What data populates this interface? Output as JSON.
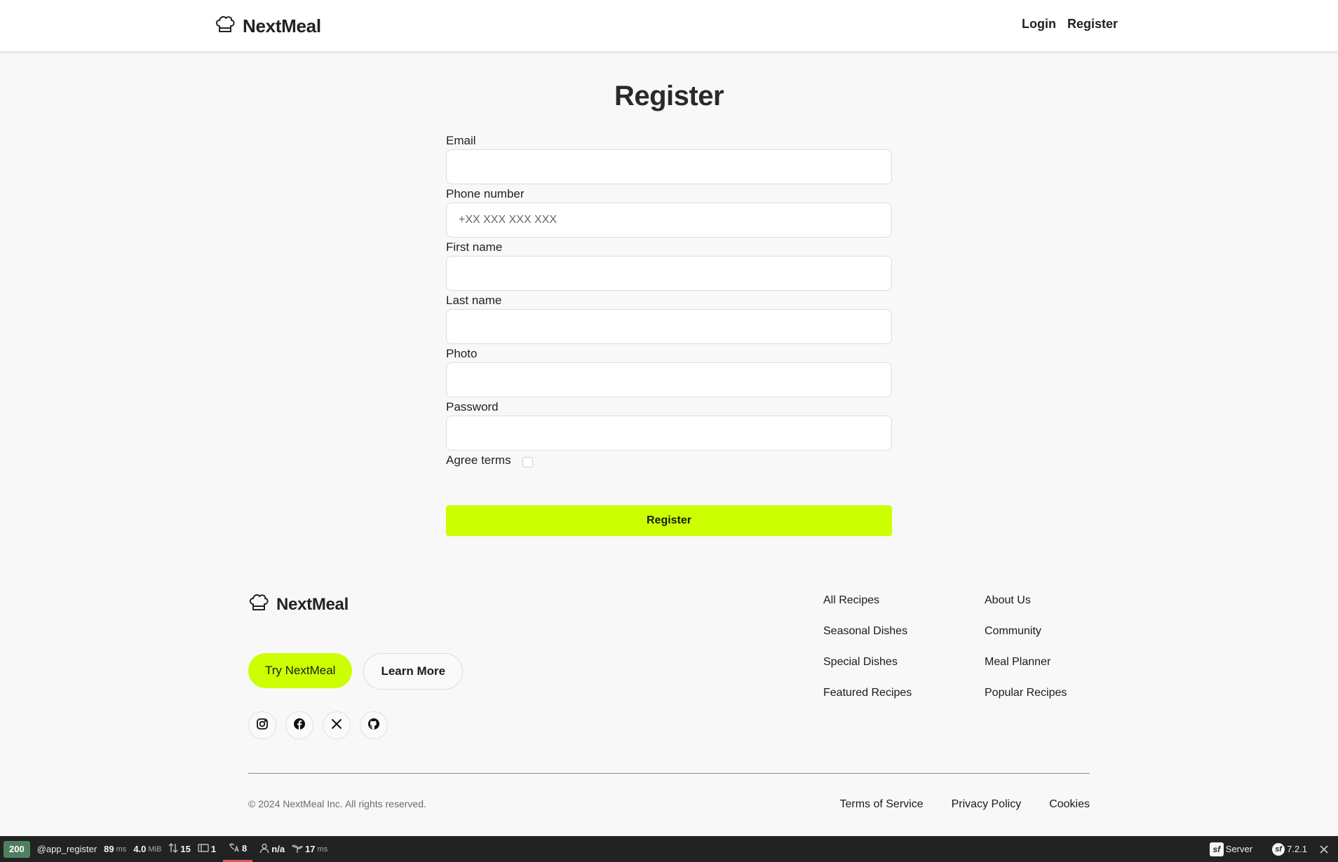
{
  "header": {
    "brand": "NextMeal",
    "nav": [
      "Login",
      "Register"
    ]
  },
  "page": {
    "title": "Register"
  },
  "form": {
    "fields": [
      {
        "label": "Email",
        "value": "",
        "placeholder": ""
      },
      {
        "label": "Phone number",
        "value": "",
        "placeholder": "+XX XXX XXX XXX"
      },
      {
        "label": "First name",
        "value": "",
        "placeholder": ""
      },
      {
        "label": "Last name",
        "value": "",
        "placeholder": ""
      },
      {
        "label": "Photo",
        "value": "",
        "placeholder": ""
      },
      {
        "label": "Password",
        "value": "",
        "placeholder": ""
      }
    ],
    "agree_label": "Agree terms",
    "agree_checked": false,
    "submit_label": "Register"
  },
  "footer": {
    "brand": "NextMeal",
    "cta_primary": "Try NextMeal",
    "cta_secondary": "Learn More",
    "socials": [
      "instagram-icon",
      "facebook-icon",
      "x-icon",
      "github-icon"
    ],
    "links_col1": [
      "All Recipes",
      "Seasonal Dishes",
      "Special Dishes",
      "Featured Recipes"
    ],
    "links_col2": [
      "About Us",
      "Community",
      "Meal Planner",
      "Popular Recipes"
    ],
    "copyright": "© 2024 NextMeal Inc. All rights reserved.",
    "legal": [
      "Terms of Service",
      "Privacy Policy",
      "Cookies"
    ]
  },
  "debug_toolbar": {
    "status": "200",
    "route": "@app_register",
    "time_value": "89",
    "time_unit": "ms",
    "memory_value": "4.0",
    "memory_unit": "MiB",
    "requests": "15",
    "forms": "1",
    "translations": "8",
    "user": "n/a",
    "twig_value": "17",
    "twig_unit": "ms",
    "server": "Server",
    "version": "7.2.1"
  },
  "colors": {
    "accent": "#ccff00",
    "status_ok": "#4f805d",
    "toolbar_bg": "#222222"
  }
}
